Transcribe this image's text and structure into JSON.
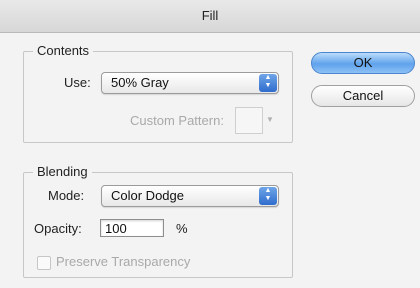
{
  "window": {
    "title": "Fill"
  },
  "contents": {
    "legend": "Contents",
    "use_label": "Use:",
    "use_value": "50% Gray",
    "custom_pattern_label": "Custom Pattern:"
  },
  "blending": {
    "legend": "Blending",
    "mode_label": "Mode:",
    "mode_value": "Color Dodge",
    "opacity_label": "Opacity:",
    "opacity_value": "100",
    "opacity_unit": "%",
    "preserve_label": "Preserve Transparency",
    "preserve_checked": false,
    "preserve_enabled": false
  },
  "buttons": {
    "ok_label": "OK",
    "cancel_label": "Cancel"
  },
  "colors": {
    "ok_button": "#5fa2ec",
    "popup_arrows": "#2f6ccd",
    "background": "#e6eff9"
  },
  "icons": {
    "popup_arrows": "up-down-arrows",
    "pattern_dropdown": "down-arrow"
  }
}
